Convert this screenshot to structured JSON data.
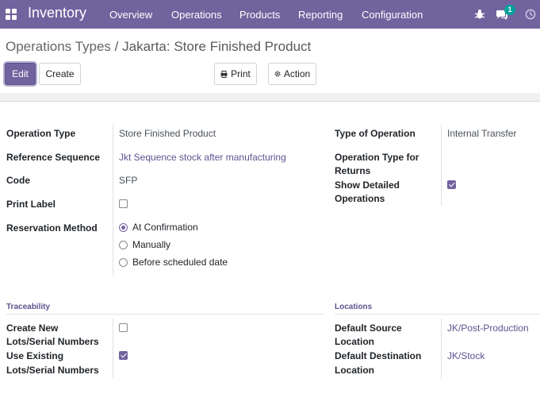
{
  "navbar": {
    "app_name": "Inventory",
    "menu": [
      "Overview",
      "Operations",
      "Products",
      "Reporting",
      "Configuration"
    ],
    "message_count": "1",
    "icons": [
      "apps-grid-icon",
      "bug-icon",
      "chat-icon",
      "clock-icon"
    ],
    "color": "#71639e"
  },
  "breadcrumb": {
    "parent": "Operations Types",
    "separator": "/",
    "current": "Jakarta: Store Finished Product"
  },
  "buttons": {
    "edit": "Edit",
    "create": "Create",
    "print": "Print",
    "action": "Action"
  },
  "form": {
    "operation_type": {
      "label": "Operation Type",
      "value": "Store Finished Product"
    },
    "reference_sequence": {
      "label": "Reference Sequence",
      "value": "Jkt Sequence stock after manufacturing"
    },
    "code": {
      "label": "Code",
      "value": "SFP"
    },
    "print_label": {
      "label": "Print Label",
      "checked": false
    },
    "reservation_method": {
      "label": "Reservation Method",
      "options": [
        "At Confirmation",
        "Manually",
        "Before scheduled date"
      ],
      "selected": "At Confirmation"
    },
    "type_of_operation": {
      "label": "Type of Operation",
      "value": "Internal Transfer"
    },
    "return_type": {
      "label_line1": "Operation Type for",
      "label_line2": "Returns",
      "value": ""
    },
    "show_detailed": {
      "label_line1": "Show Detailed",
      "label_line2": "Operations",
      "checked": true
    }
  },
  "traceability": {
    "title": "Traceability",
    "create_new": {
      "label_line1": "Create New",
      "label_line2": "Lots/Serial Numbers",
      "checked": false
    },
    "use_existing": {
      "label_line1": "Use Existing",
      "label_line2": "Lots/Serial Numbers",
      "checked": true
    }
  },
  "locations": {
    "title": "Locations",
    "source": {
      "label_line1": "Default Source",
      "label_line2": "Location",
      "value": "JK/Post-Production"
    },
    "destination": {
      "label_line1": "Default Destination",
      "label_line2": "Location",
      "value": "JK/Stock"
    }
  }
}
